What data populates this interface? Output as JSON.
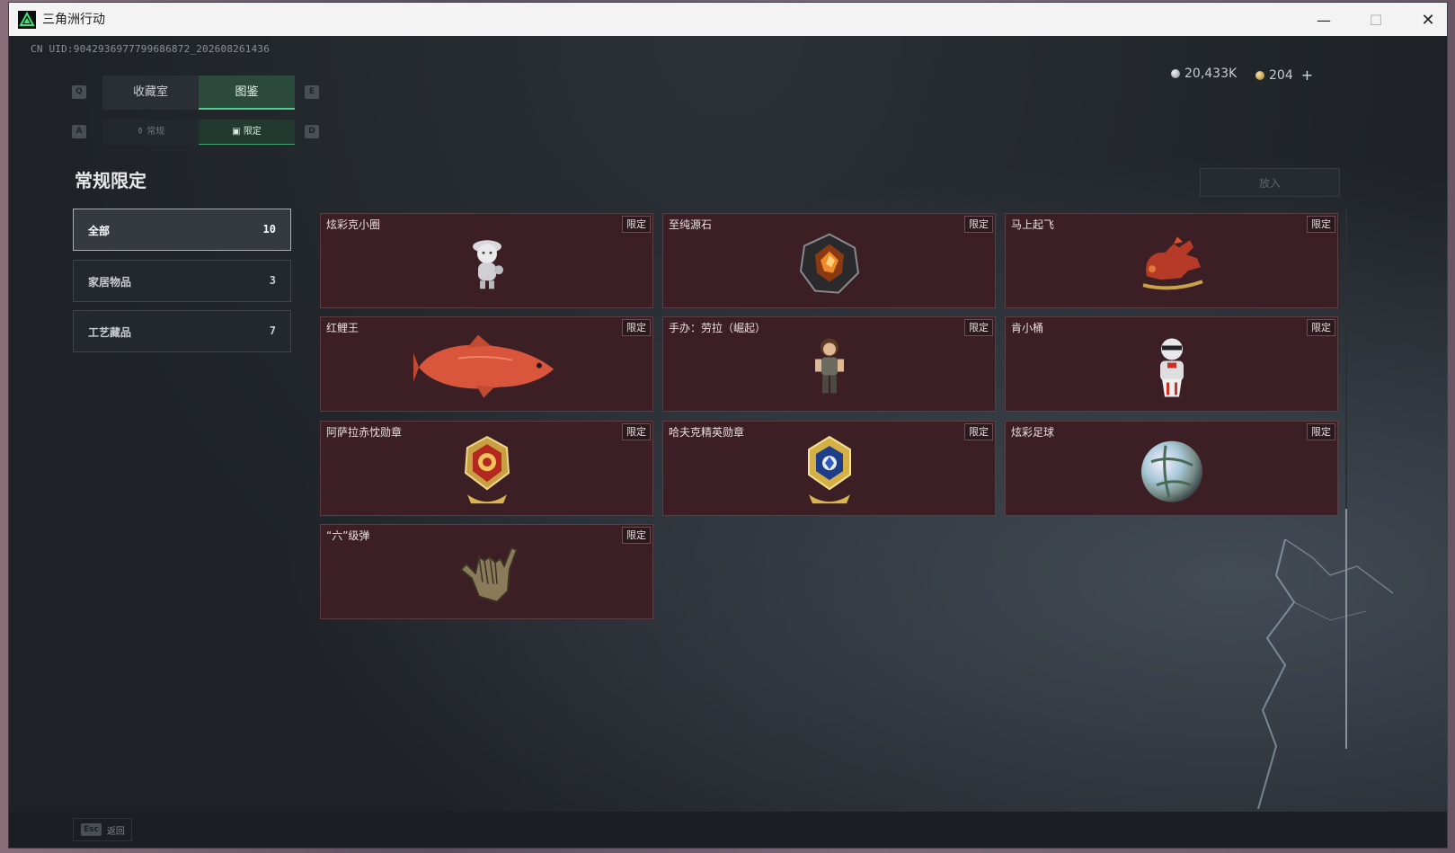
{
  "window": {
    "title": "三角洲行动"
  },
  "uid": "CN UID:9042936977799686872_202608261436",
  "tabs_main": {
    "left_key": "Q",
    "right_key": "E",
    "items": [
      {
        "label": "收藏室"
      },
      {
        "label": "图鉴"
      }
    ]
  },
  "tabs_sub": {
    "left_key": "A",
    "right_key": "D",
    "items": [
      {
        "label": "常规"
      },
      {
        "label": "限定"
      }
    ]
  },
  "currency": {
    "silver": "20,433K",
    "gold": "204",
    "plus": "+"
  },
  "section_title": "常规限定",
  "put_button": "放入",
  "categories": [
    {
      "label": "全部",
      "count": "10"
    },
    {
      "label": "家居物品",
      "count": "3"
    },
    {
      "label": "工艺藏品",
      "count": "7"
    }
  ],
  "items": [
    {
      "name": "炫彩克小圈",
      "tag": "限定"
    },
    {
      "name": "至纯源石",
      "tag": "限定"
    },
    {
      "name": "马上起飞",
      "tag": "限定"
    },
    {
      "name": "红鲤王",
      "tag": "限定"
    },
    {
      "name": "手办：劳拉（崛起）",
      "tag": "限定"
    },
    {
      "name": "肯小桶",
      "tag": "限定"
    },
    {
      "name": "阿萨拉赤忱勋章",
      "tag": "限定"
    },
    {
      "name": "哈夫克精英勋章",
      "tag": "限定"
    },
    {
      "name": "炫彩足球",
      "tag": "限定"
    },
    {
      "name": "“六”级弹",
      "tag": "限定"
    }
  ],
  "bottom": {
    "esc_key": "Esc",
    "esc_label": "返回"
  },
  "colors": {
    "accent": "#4fd08a",
    "card_bg": "#3b1f24",
    "app_bg": "#1f2327"
  }
}
